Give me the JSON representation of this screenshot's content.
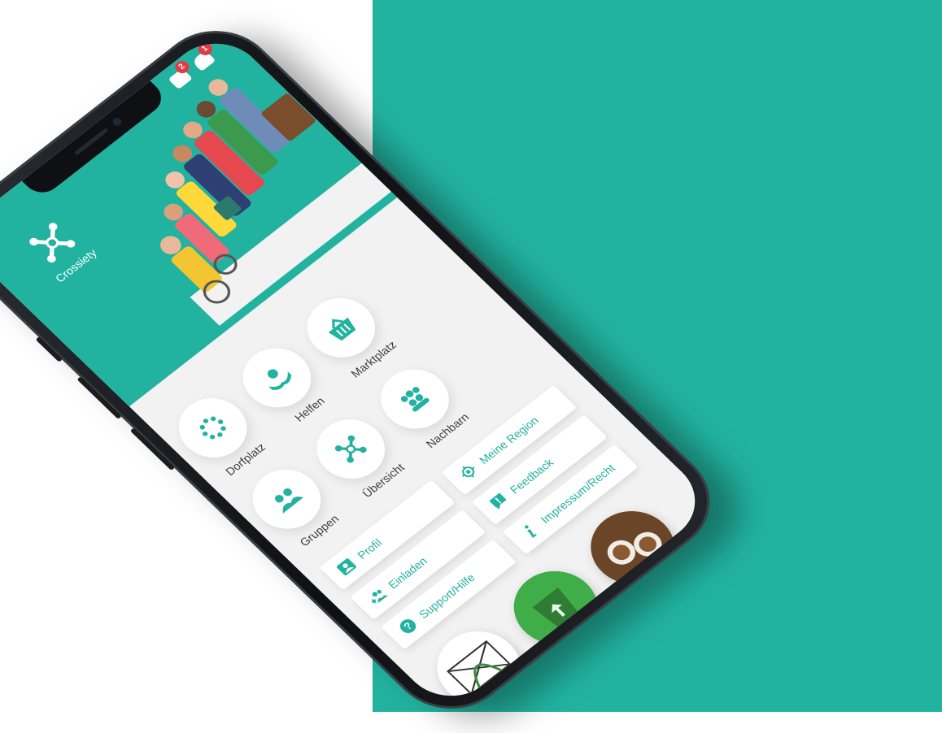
{
  "app": {
    "brand_name": "Crossiety"
  },
  "status": {
    "messages_count": "2",
    "notifications_count": "1"
  },
  "tiles": [
    {
      "label": "Dorfplatz",
      "icon": "circle-dots-icon"
    },
    {
      "label": "Helfen",
      "icon": "helping-hand-icon"
    },
    {
      "label": "Marktplatz",
      "icon": "basket-icon"
    },
    {
      "label": "Gruppen",
      "icon": "group-icon"
    },
    {
      "label": "Übersicht",
      "icon": "network-icon"
    },
    {
      "label": "Nachbarn",
      "icon": "neighbors-icon"
    }
  ],
  "menu": [
    {
      "label": "Profil",
      "icon": "profile-card-icon"
    },
    {
      "label": "Einladen",
      "icon": "add-user-icon"
    },
    {
      "label": "Support/Hilfe",
      "icon": "help-circle-icon"
    },
    {
      "label": "Meine Region",
      "icon": "location-target-icon"
    },
    {
      "label": "Feedback",
      "icon": "feedback-bubble-icon"
    },
    {
      "label": "Impressum/Recht",
      "icon": "info-icon"
    }
  ],
  "colors": {
    "brand": "#22b3a0",
    "badge": "#e53945",
    "screen_bg": "#f2f2f2"
  }
}
